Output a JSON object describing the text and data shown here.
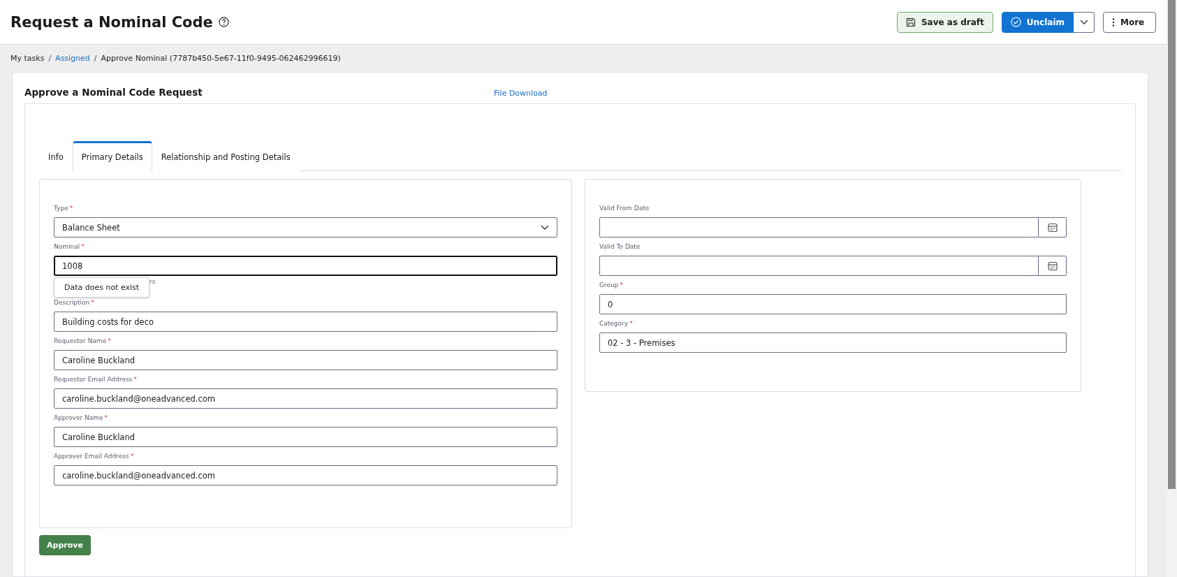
{
  "header": {
    "title": "Request a Nominal Code",
    "buttons": [
      {
        "kind": "draft",
        "label": "Save as draft"
      },
      {
        "kind": "split",
        "label": "Unclaim"
      },
      {
        "kind": "more",
        "label": "More"
      }
    ]
  },
  "breadcrumb": [
    {
      "label": "My tasks",
      "link": false
    },
    {
      "label": "Assigned",
      "link": true
    },
    {
      "label": "Approve Nominal (7787b450-5e67-11f0-9495-062462996619)",
      "link": false
    }
  ],
  "card": {
    "title": "Approve a Nominal Code Request",
    "link": "File Download"
  },
  "tabs": [
    {
      "label": "Info",
      "selected": false
    },
    {
      "label": "Primary Details",
      "selected": true
    },
    {
      "label": "Relationship and Posting Details",
      "selected": false
    }
  ],
  "left_fields": [
    {
      "kind": "select",
      "label": "Type",
      "required": true,
      "value": "Balance Sheet",
      "focused": false
    },
    {
      "kind": "text",
      "label": "Nominal",
      "required": true,
      "value": "1008",
      "focused": true,
      "helper": "rs",
      "tooltip": "Data does not exist"
    },
    {
      "kind": "text",
      "label": "Description",
      "required": true,
      "value": "Building costs for deco",
      "focused": false
    },
    {
      "kind": "text",
      "label": "Requestor Name",
      "required": true,
      "value": "Caroline Buckland",
      "focused": false
    },
    {
      "kind": "text",
      "label": "Requestor Email Address",
      "required": true,
      "value": "caroline.buckland@oneadvanced.com",
      "focused": false
    },
    {
      "kind": "text",
      "label": "Approver Name",
      "required": true,
      "value": "Caroline Buckland",
      "focused": false
    },
    {
      "kind": "text",
      "label": "Approver Email Address",
      "required": true,
      "value": "caroline.buckland@oneadvanced.com",
      "focused": false
    }
  ],
  "right_fields": [
    {
      "kind": "date",
      "label": "Valid From Date",
      "required": false
    },
    {
      "kind": "date",
      "label": "Valid To Date",
      "required": false
    },
    {
      "kind": "text",
      "label": "Group",
      "required": true,
      "value": "0",
      "focused": false
    },
    {
      "kind": "text",
      "label": "Category",
      "required": true,
      "value": "02 - 3 - Premises",
      "focused": false
    }
  ],
  "approve_button": "Approve",
  "required_mark": "*",
  "breadcrumb_separator": "/"
}
